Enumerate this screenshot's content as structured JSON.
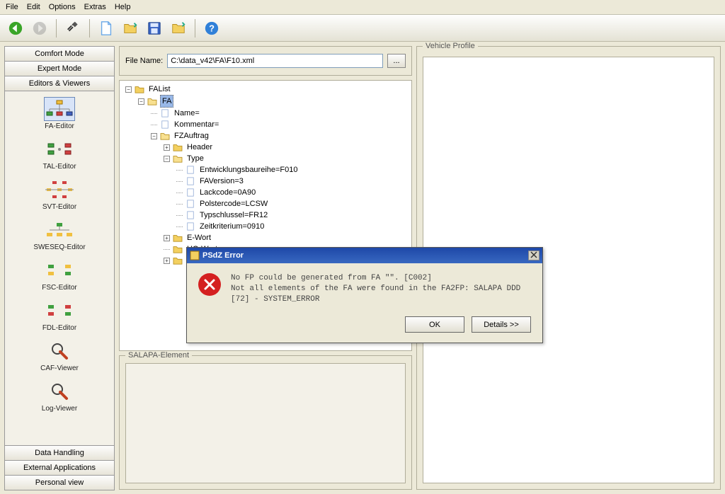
{
  "menu": {
    "items": [
      "File",
      "Edit",
      "Options",
      "Extras",
      "Help"
    ]
  },
  "sidebar": {
    "btn0": "Comfort Mode",
    "btn1": "Expert Mode",
    "btn2": "Editors & Viewers",
    "btn3": "Data Handling",
    "btn4": "External Applications",
    "btn5": "Personal view",
    "tools": [
      {
        "label": "FA-Editor"
      },
      {
        "label": "TAL-Editor"
      },
      {
        "label": "SVT-Editor"
      },
      {
        "label": "SWESEQ-Editor"
      },
      {
        "label": "FSC-Editor"
      },
      {
        "label": "FDL-Editor"
      },
      {
        "label": "CAF-Viewer"
      },
      {
        "label": "Log-Viewer"
      }
    ]
  },
  "filebox": {
    "label": "File Name:",
    "value": "C:\\data_v42\\FA\\F10.xml",
    "browse": "..."
  },
  "tree": {
    "root": "FAList",
    "fa": "FA",
    "nodes": {
      "name": "Name=",
      "kommentar": "Kommentar=",
      "fzauftrag": "FZAuftrag",
      "header": "Header",
      "type": "Type",
      "entw": "Entwicklungsbaureihe=F010",
      "fav": "FAVersion=3",
      "lack": "Lackcode=0A90",
      "polster": "Polstercode=LCSW",
      "typ": "Typschlussel=FR12",
      "zeit": "Zeitkriterium=0910",
      "ewort": "E-Wort",
      "howort": "HO-Wort"
    }
  },
  "salapa": {
    "title": "SALAPA-Element"
  },
  "vehicle": {
    "title": "Vehicle Profile"
  },
  "dialog": {
    "title": "PSdZ Error",
    "msg": "No FP could be generated from FA \"\". [C002]\nNot all elements of the FA were found in the FA2FP: SALAPA DDD\n[72] - SYSTEM_ERROR",
    "ok": "OK",
    "details": "Details >>"
  }
}
